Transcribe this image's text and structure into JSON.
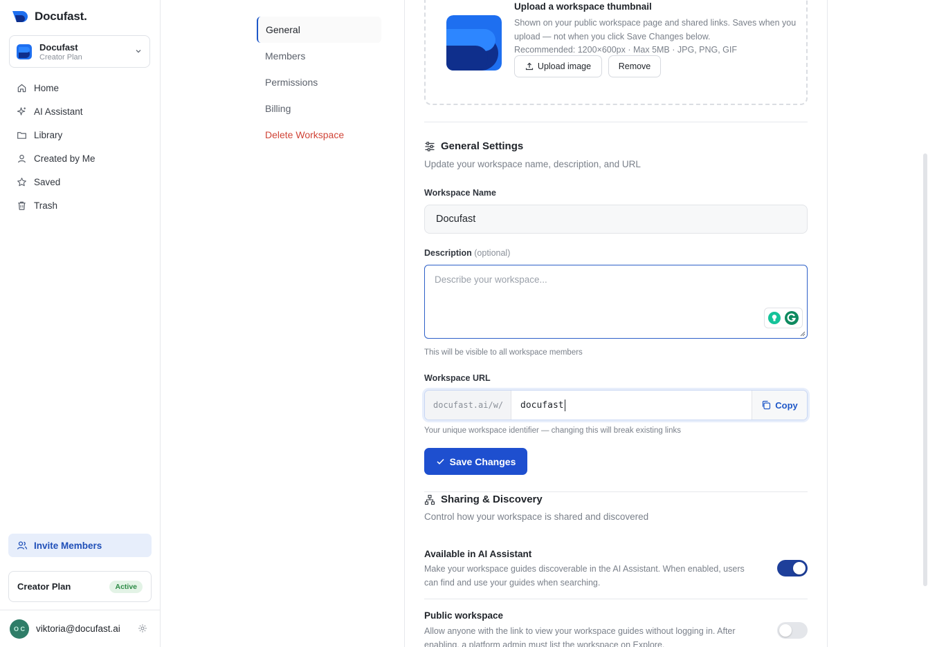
{
  "brand": {
    "name": "Docufast."
  },
  "workspace": {
    "name": "Docufast",
    "plan": "Creator Plan"
  },
  "sidebar": {
    "items": [
      {
        "label": "Home",
        "icon": "home-icon"
      },
      {
        "label": "AI Assistant",
        "icon": "sparkle-icon"
      },
      {
        "label": "Library",
        "icon": "folder-icon"
      },
      {
        "label": "Created by Me",
        "icon": "user-icon"
      },
      {
        "label": "Saved",
        "icon": "star-icon"
      },
      {
        "label": "Trash",
        "icon": "trash-icon"
      }
    ],
    "invite_label": "Invite Members",
    "plan_name": "Creator Plan",
    "plan_status": "Active",
    "user_initials": "O C",
    "user_email": "viktoria@docufast.ai"
  },
  "settings_nav": {
    "items": [
      "General",
      "Members",
      "Permissions",
      "Billing",
      "Delete Workspace"
    ]
  },
  "thumbnail": {
    "title": "Upload a workspace thumbnail",
    "desc": "Shown on your public workspace page and shared links. Saves when you upload — not when you click Save Changes below.",
    "specs": "Recommended: 1200×600px · Max 5MB · JPG, PNG, GIF",
    "upload_label": "Upload image",
    "remove_label": "Remove"
  },
  "general": {
    "title": "General Settings",
    "subtitle": "Update your workspace name, description, and URL",
    "name_label": "Workspace Name",
    "name_value": "Docufast",
    "desc_label": "Description",
    "desc_optional": "(optional)",
    "desc_placeholder": "Describe your workspace...",
    "desc_hint": "This will be visible to all workspace members",
    "url_label": "Workspace URL",
    "url_prefix": "docufast.ai/w/",
    "url_slug": "docufast",
    "copy_label": "Copy",
    "url_hint": "Your unique workspace identifier — changing this will break existing links",
    "save_label": "Save Changes"
  },
  "sharing": {
    "title": "Sharing & Discovery",
    "subtitle": "Control how your workspace is shared and discovered",
    "ai": {
      "title": "Available in AI Assistant",
      "desc": "Make your workspace guides discoverable in the AI Assistant. When enabled, users can find and use your guides when searching.",
      "enabled": true
    },
    "public": {
      "title": "Public workspace",
      "desc": "Allow anyone with the link to view your workspace guides without logging in. After enabling, a platform admin must list the workspace on Explore.",
      "enabled": false
    }
  },
  "colors": {
    "accent": "#1e4fcf",
    "danger": "#d04437",
    "active_badge": "#2c8a45"
  }
}
